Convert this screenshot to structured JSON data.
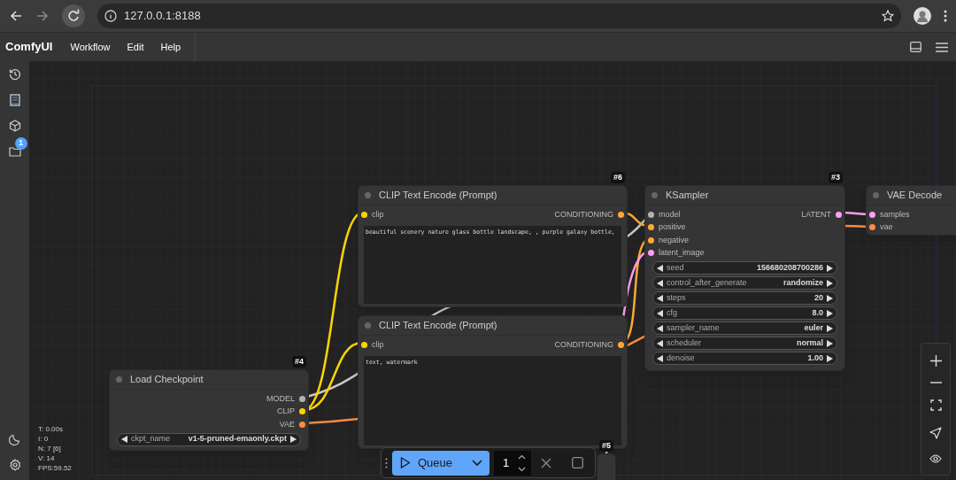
{
  "browser": {
    "url": "127.0.0.1:8188"
  },
  "menu": {
    "brand": "ComfyUI",
    "items": [
      "Workflow",
      "Edit",
      "Help"
    ]
  },
  "sidebar": {
    "badge": "1"
  },
  "nodes": [
    {
      "title": "CLIP Text Encode (Prompt)",
      "badge": "#6",
      "inputs": [
        {
          "label": "clip",
          "color": "#ffd500"
        }
      ],
      "outputs": [
        {
          "label": "CONDITIONING",
          "color": "#ffa931"
        }
      ],
      "text": "beautiful scenery nature glass bottle landscape, , purple galaxy bottle,"
    },
    {
      "title": "CLIP Text Encode (Prompt)",
      "inputs": [
        {
          "label": "clip",
          "color": "#ffd500"
        }
      ],
      "outputs": [
        {
          "label": "CONDITIONING",
          "color": "#ffa931"
        }
      ],
      "text": "text, watermark"
    },
    {
      "title": "KSampler",
      "badge": "#3",
      "inputs": [
        {
          "label": "model",
          "color": "#b2b2b2"
        },
        {
          "label": "positive",
          "color": "#ffa931"
        },
        {
          "label": "negative",
          "color": "#ffa931"
        },
        {
          "label": "latent_image",
          "color": "#ff9cf9"
        }
      ],
      "outputs": [
        {
          "label": "LATENT",
          "color": "#ff9cf9"
        }
      ],
      "widgets": [
        {
          "label": "seed",
          "value": "156680208700286"
        },
        {
          "label": "control_after_generate",
          "value": "randomize"
        },
        {
          "label": "steps",
          "value": "20"
        },
        {
          "label": "cfg",
          "value": "8.0"
        },
        {
          "label": "sampler_name",
          "value": "euler"
        },
        {
          "label": "scheduler",
          "value": "normal"
        },
        {
          "label": "denoise",
          "value": "1.00"
        }
      ]
    },
    {
      "title": "Load Checkpoint",
      "badge": "#4",
      "outputs": [
        {
          "label": "MODEL",
          "color": "#b2b2b2"
        },
        {
          "label": "CLIP",
          "color": "#ffd500"
        },
        {
          "label": "VAE",
          "color": "#ff8c42"
        }
      ],
      "widgets": [
        {
          "label": "ckpt_name",
          "value": "v1-5-pruned-emaonly.ckpt"
        }
      ]
    },
    {
      "title": "VAE Decode",
      "inputs": [
        {
          "label": "samples",
          "color": "#ff9cf9"
        },
        {
          "label": "vae",
          "color": "#ff8c42"
        }
      ]
    },
    {
      "badge": "#5"
    }
  ],
  "stats": [
    "T: 0.00s",
    "I: 0",
    "N: 7 [6]",
    "V: 14",
    "FPS:59.52"
  ],
  "queue": {
    "label": "Queue",
    "count": "1"
  }
}
